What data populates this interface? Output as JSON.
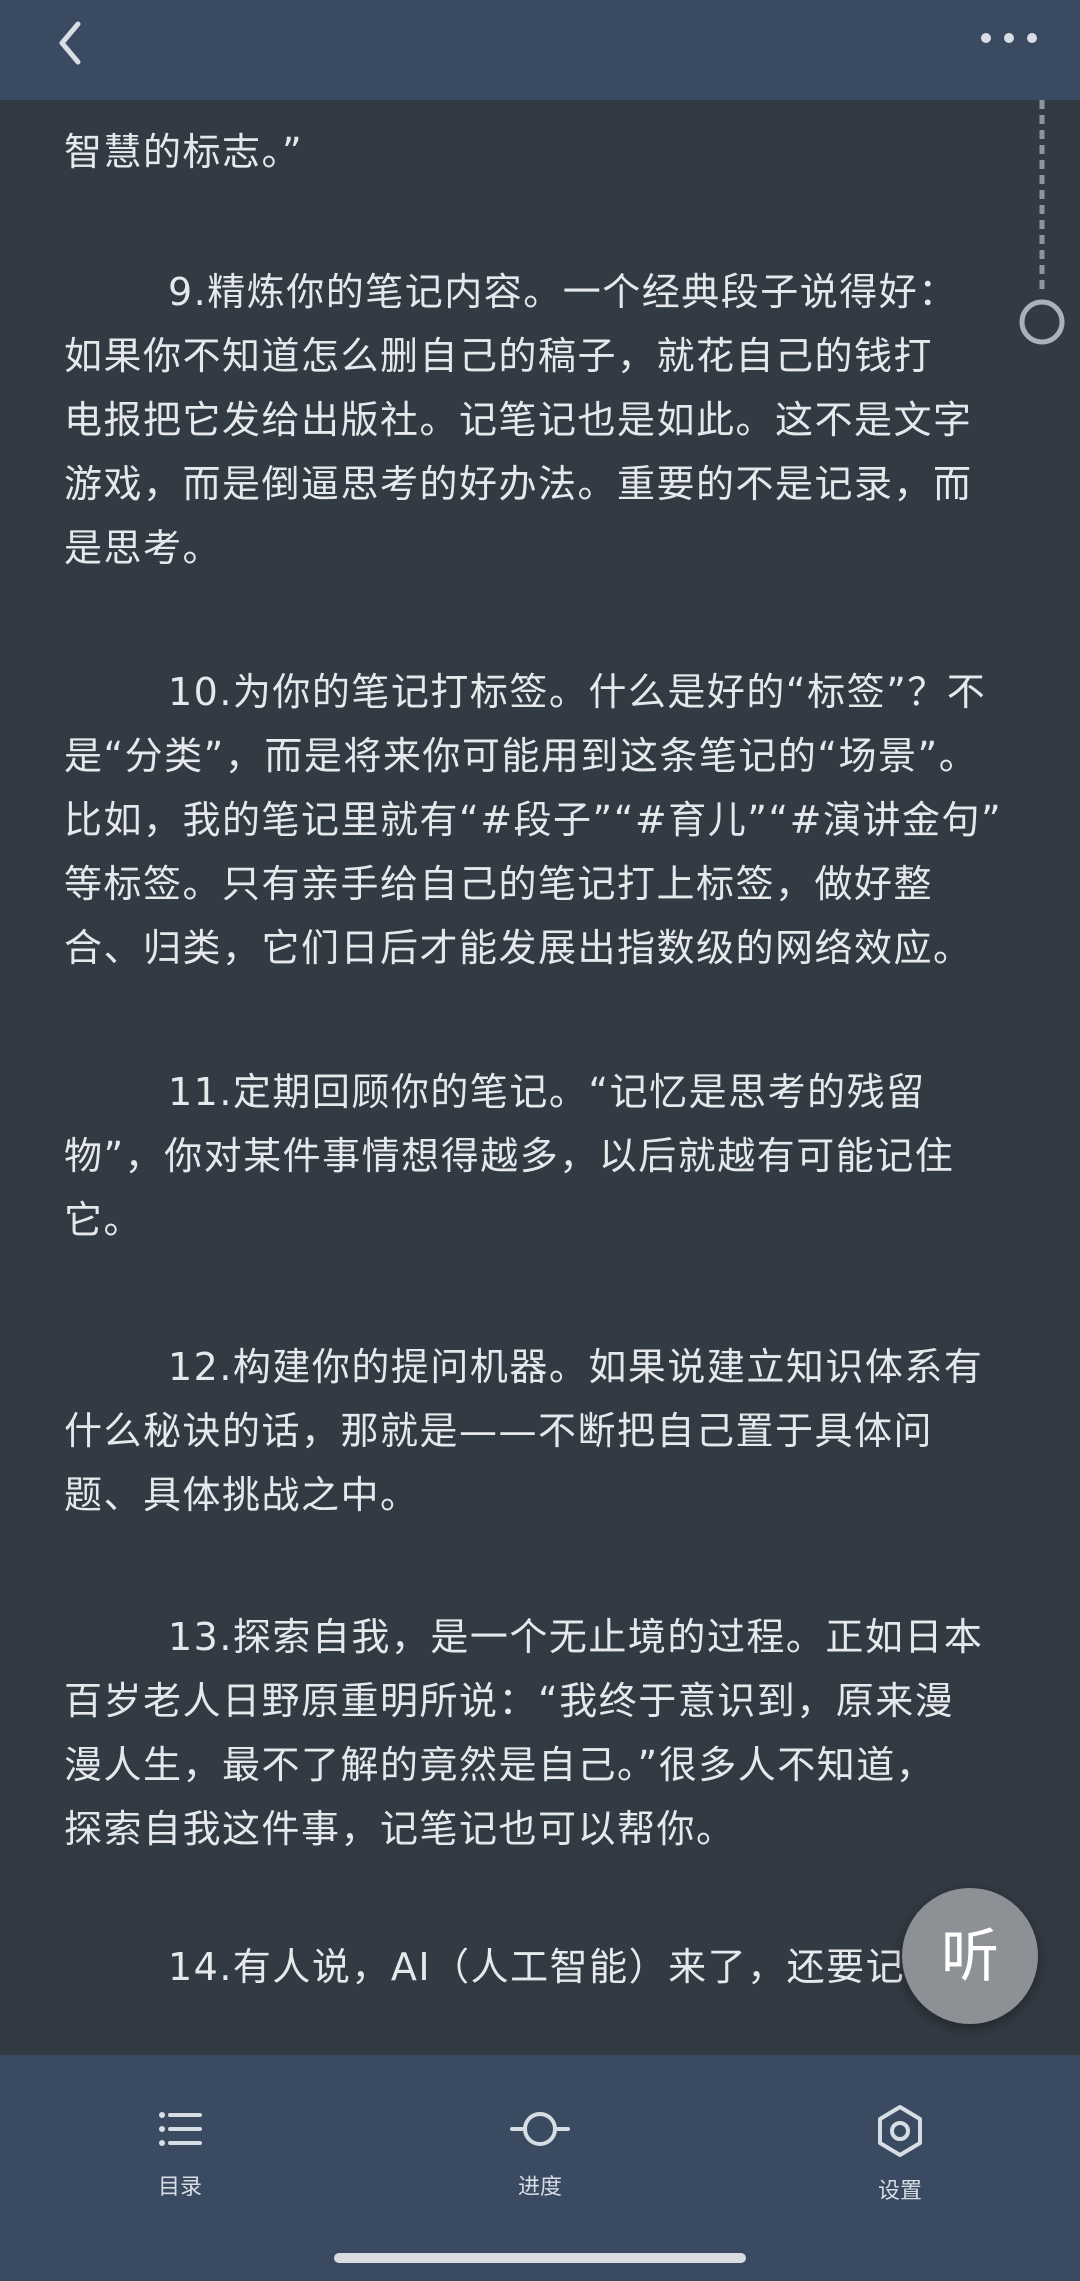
{
  "header": {
    "back_icon": "chevron-left-icon",
    "more_icon": "more-icon"
  },
  "content": {
    "paragraphs": [
      {
        "lines": [
          "智慧的标志。”"
        ]
      },
      {
        "lines": [
          "9.精炼你的笔记内容。一个经典段子说得好：",
          "如果你不知道怎么删自己的稿子，就花自己的钱打",
          "电报把它发给出版社。记笔记也是如此。这不是文字",
          "游戏，而是倒逼思考的好办法。重要的不是记录，而",
          "是思考。"
        ]
      },
      {
        "lines": [
          "10.为你的笔记打标签。什么是好的“标签”？不",
          "是“分类”，而是将来你可能用到这条笔记的“场景”。",
          "比如，我的笔记里就有“#段子”“#育儿”“#演讲金句”",
          "等标签。只有亲手给自己的笔记打上标签，做好整",
          "合、归类，它们日后才能发展出指数级的网络效应。"
        ]
      },
      {
        "lines": [
          "11.定期回顾你的笔记。“记忆是思考的残留",
          "物”，你对某件事情想得越多，以后就越有可能记住",
          "它。"
        ]
      },
      {
        "lines": [
          "12.构建你的提问机器。如果说建立知识体系有",
          "什么秘诀的话，那就是——不断把自己置于具体问",
          "题、具体挑战之中。"
        ]
      },
      {
        "lines": [
          "13.探索自我，是一个无止境的过程。正如日本",
          "百岁老人日野原重明所说：“我终于意识到，原来漫",
          "漫人生，最不了解的竟然是自己。”很多人不知道，",
          "探索自我这件事，记笔记也可以帮你。"
        ]
      },
      {
        "lines": [
          "14.有人说，AI（人工智能）来了，还要记笔记"
        ]
      }
    ]
  },
  "listen_button": {
    "label": "听"
  },
  "bottom_nav": {
    "items": [
      {
        "label": "目录",
        "icon": "list-icon"
      },
      {
        "label": "进度",
        "icon": "progress-icon"
      },
      {
        "label": "设置",
        "icon": "settings-icon"
      }
    ]
  },
  "colors": {
    "background": "#323a43",
    "bars": "#3a4a61",
    "text": "#e6e9ec",
    "listen_button": "#8d9196"
  }
}
